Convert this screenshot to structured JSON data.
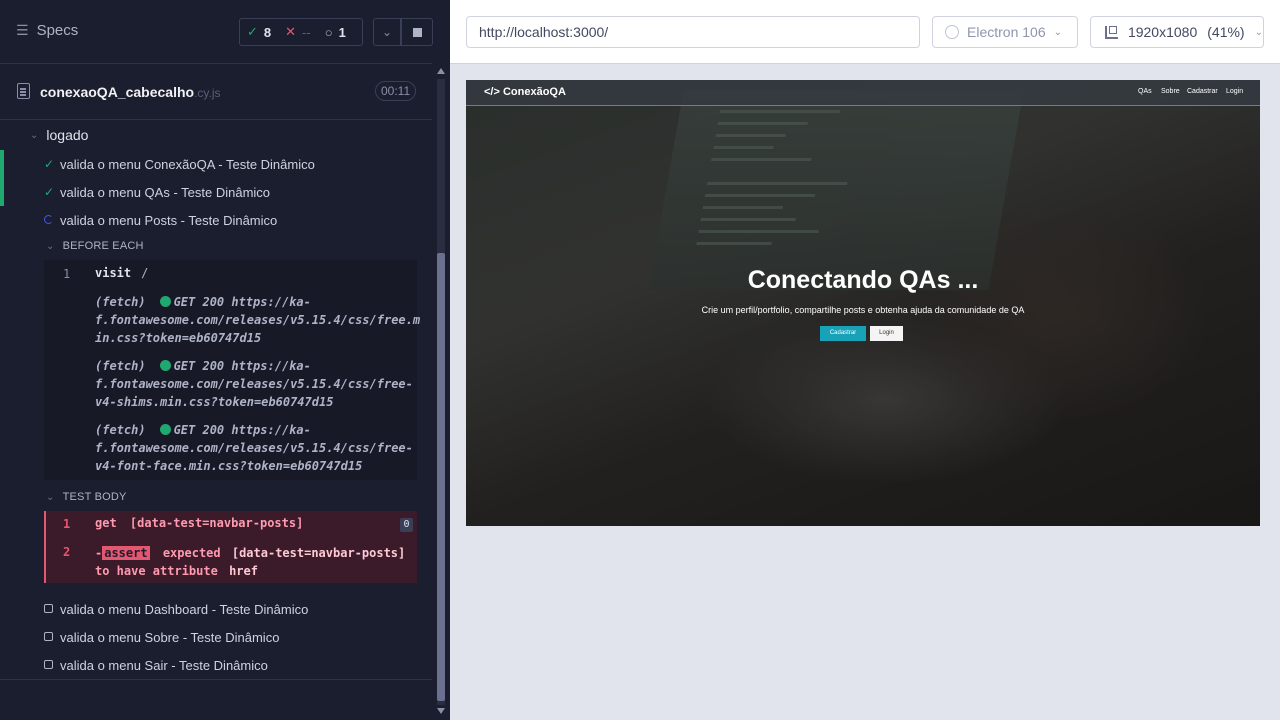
{
  "reporter": {
    "specs_label": "Specs",
    "stats": {
      "passed": "8",
      "failed": "--",
      "pending": "1"
    },
    "file": {
      "name": "conexaoQA_cabecalho",
      "ext": ".cy.js",
      "duration": "00:11"
    },
    "suite_title": "logado",
    "tests": [
      {
        "title": "valida o menu ConexãoQA - Teste Dinâmico",
        "state": "passed"
      },
      {
        "title": "valida o menu QAs - Teste Dinâmico",
        "state": "passed"
      },
      {
        "title": "valida o menu Posts - Teste Dinâmico",
        "state": "running"
      },
      {
        "title": "valida o menu Dashboard - Teste Dinâmico",
        "state": "pending"
      },
      {
        "title": "valida o menu Sobre - Teste Dinâmico",
        "state": "pending"
      },
      {
        "title": "valida o menu Sair - Teste Dinâmico",
        "state": "pending"
      }
    ],
    "before_each": {
      "title": "BEFORE EACH",
      "commands": [
        {
          "num": "1",
          "name": "visit",
          "arg": "/"
        }
      ],
      "fetches": [
        {
          "prefix": "(fetch)",
          "line1": "GET 200 https://ka-",
          "line2": "f.fontawesome.com/releases/v5.15.4/css/free.m",
          "line3": "in.css?token=eb60747d15"
        },
        {
          "prefix": "(fetch)",
          "line1": "GET 200 https://ka-",
          "line2": "f.fontawesome.com/releases/v5.15.4/css/free-",
          "line3": "v4-shims.min.css?token=eb60747d15"
        },
        {
          "prefix": "(fetch)",
          "line1": "GET 200 https://ka-",
          "line2": "f.fontawesome.com/releases/v5.15.4/css/free-",
          "line3": "v4-font-face.min.css?token=eb60747d15"
        }
      ]
    },
    "test_body": {
      "title": "TEST BODY",
      "cmd1": {
        "num": "1",
        "name": "get",
        "arg": "[data-test=navbar-posts]",
        "badge": "0"
      },
      "cmd2": {
        "num": "2",
        "dash": "-",
        "name": "assert",
        "expected": "expected",
        "selector": "[data-test=navbar-posts]",
        "rest": "to have attribute",
        "attr": "href"
      }
    }
  },
  "preview": {
    "url": "http://localhost:3000/",
    "browser": "Electron 106",
    "viewport": "1920x1080",
    "scale": "(41%)"
  },
  "aut": {
    "logo": "</> ConexãoQA",
    "nav": [
      "QAs",
      "Sobre",
      "Cadastrar",
      "Login"
    ],
    "title": "Conectando QAs ...",
    "subtitle": "Crie um perfil/portfolio, compartilhe posts e obtenha ajuda da comunidade de QA",
    "btn_register": "Cadastrar",
    "btn_login": "Login"
  },
  "colors": {
    "pass": "#1fa971",
    "fail": "#e45770",
    "accent": "#17a2b8",
    "panel": "#1b1e2e"
  }
}
